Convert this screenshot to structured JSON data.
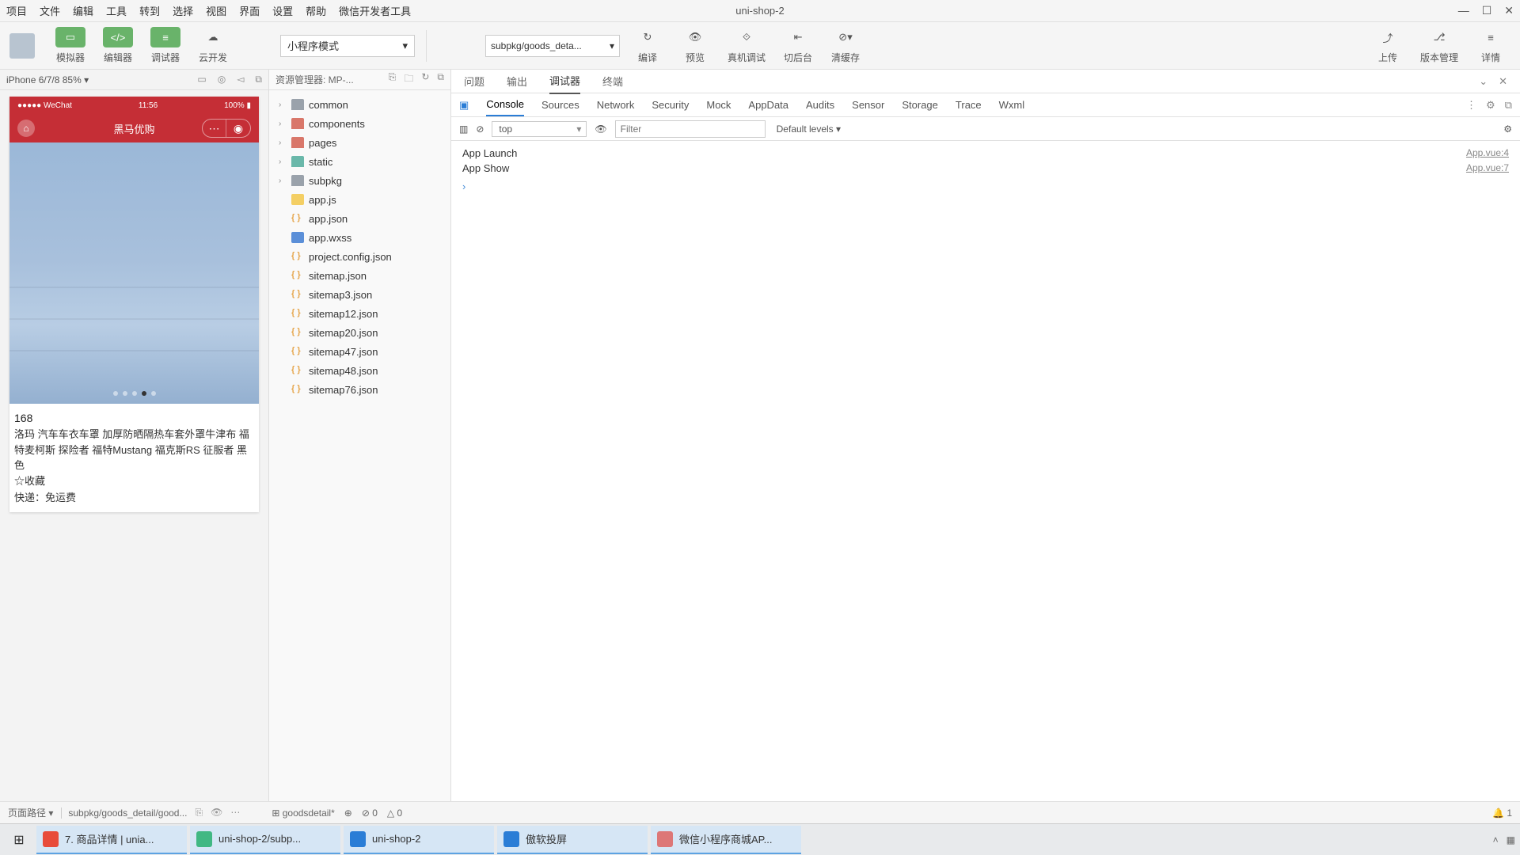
{
  "menubar": {
    "items": [
      "项目",
      "文件",
      "编辑",
      "工具",
      "转到",
      "选择",
      "视图",
      "界面",
      "设置",
      "帮助",
      "微信开发者工具"
    ],
    "title": "uni-shop-2"
  },
  "toolbar": {
    "sim": "模拟器",
    "edit": "编辑器",
    "dbg": "调试器",
    "cloud": "云开发",
    "mode": "小程序模式",
    "pathdd": "subpkg/goods_deta...",
    "compile": "编译",
    "preview": "预览",
    "realdbg": "真机调试",
    "back": "切后台",
    "clear": "清缓存",
    "upload": "上传",
    "vc": "版本管理",
    "detail": "详情"
  },
  "simulator": {
    "device": "iPhone 6/7/8 85%",
    "status": {
      "carrier": "●●●●● WeChat",
      "time": "11:56",
      "battery": "100%"
    },
    "nav_title": "黑马优购",
    "price": "168",
    "desc": "洛玛 汽车车衣车罩 加厚防晒隔热车套外罩牛津布 福特麦柯斯 探险者 福特Mustang 福克斯RS 征服者 黑色",
    "fav": "☆收藏",
    "ship": "快递：免运费"
  },
  "explorer": {
    "title": "资源管理器: MP-...",
    "folders": [
      {
        "name": "common",
        "chev": "›",
        "cls": "folder"
      },
      {
        "name": "components",
        "chev": "›",
        "cls": "folder red"
      },
      {
        "name": "pages",
        "chev": "›",
        "cls": "folder red"
      },
      {
        "name": "static",
        "chev": "›",
        "cls": "folder cyan"
      },
      {
        "name": "subpkg",
        "chev": "›",
        "cls": "folder"
      }
    ],
    "files": [
      {
        "name": "app.js",
        "cls": "js"
      },
      {
        "name": "app.json",
        "cls": "json"
      },
      {
        "name": "app.wxss",
        "cls": "css"
      },
      {
        "name": "project.config.json",
        "cls": "json"
      },
      {
        "name": "sitemap.json",
        "cls": "json"
      },
      {
        "name": "sitemap3.json",
        "cls": "json"
      },
      {
        "name": "sitemap12.json",
        "cls": "json"
      },
      {
        "name": "sitemap20.json",
        "cls": "json"
      },
      {
        "name": "sitemap47.json",
        "cls": "json"
      },
      {
        "name": "sitemap48.json",
        "cls": "json"
      },
      {
        "name": "sitemap76.json",
        "cls": "json"
      }
    ]
  },
  "devtools": {
    "tabs1": [
      "问题",
      "输出",
      "调试器",
      "终端"
    ],
    "tabs1_active": 2,
    "tabs2": [
      "Console",
      "Sources",
      "Network",
      "Security",
      "Mock",
      "AppData",
      "Audits",
      "Sensor",
      "Storage",
      "Trace",
      "Wxml"
    ],
    "tabs2_active": 0,
    "context": "top",
    "filter_ph": "Filter",
    "levels": "Default levels ▾",
    "logs": [
      {
        "msg": "App Launch",
        "src": "App.vue:4"
      },
      {
        "msg": "App Show",
        "src": "App.vue:7"
      }
    ]
  },
  "footer": {
    "pathlabel": "页面路径 ▾",
    "path": "subpkg/goods_detail/good...",
    "comp": "goodsdetail*",
    "err": "0",
    "warn": "0",
    "notif": "1"
  },
  "taskbar": {
    "items": [
      {
        "label": "7. 商品详情 | unia...",
        "color": "#e84b3a"
      },
      {
        "label": "uni-shop-2/subp...",
        "color": "#41b883"
      },
      {
        "label": "uni-shop-2",
        "color": "#2a7dd6"
      },
      {
        "label": "傲软投屏",
        "color": "#2a7dd6"
      },
      {
        "label": "微信小程序商城AP...",
        "color": "#d77"
      }
    ]
  }
}
